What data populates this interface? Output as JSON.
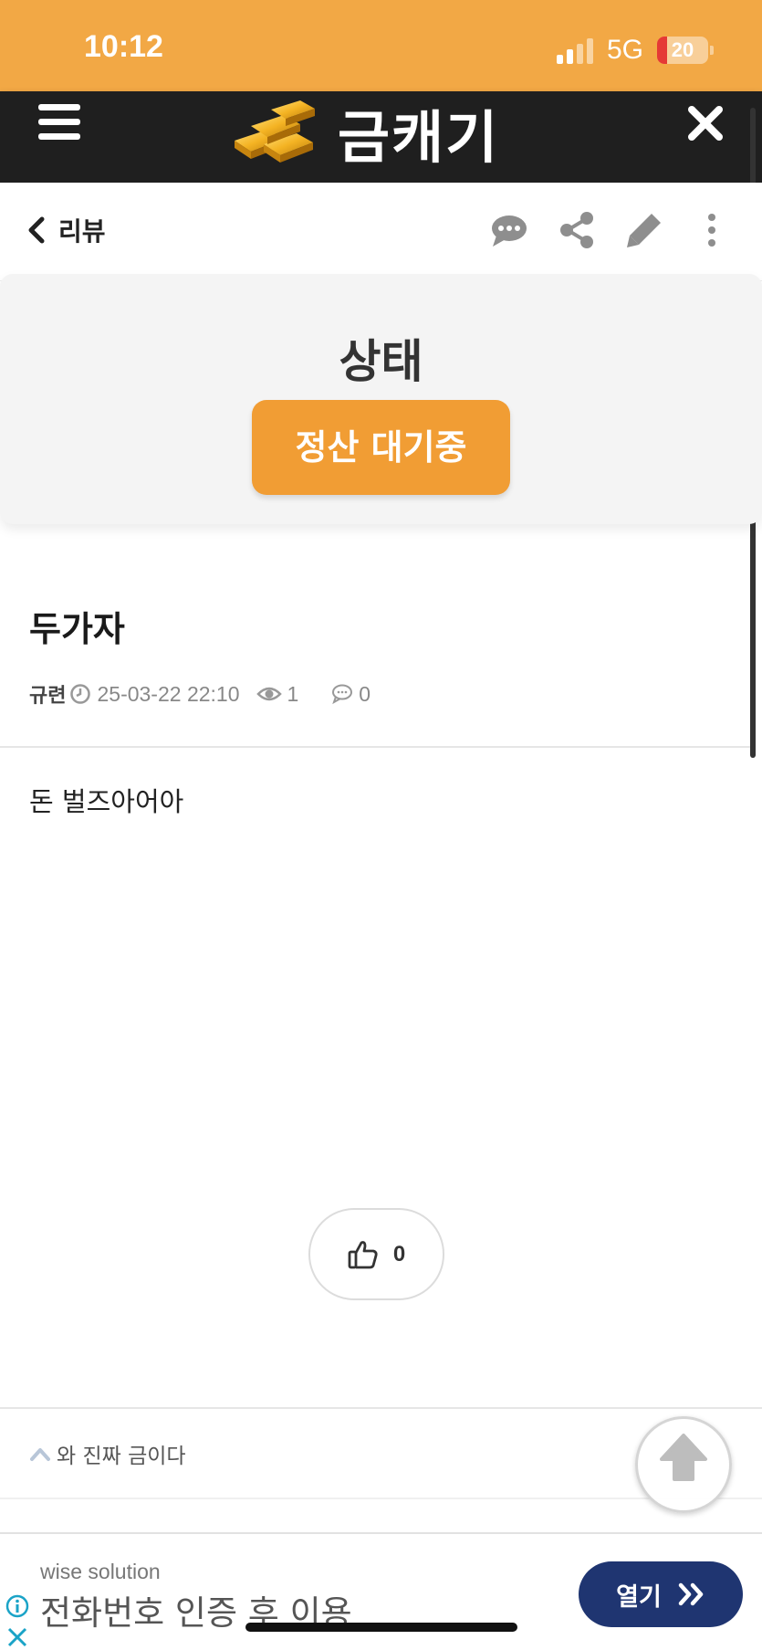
{
  "status_bar": {
    "time": "10:12",
    "network": "5G",
    "battery": "20",
    "battery_level": 0.2,
    "battery_color": "#e53935"
  },
  "header": {
    "logo_text": "금캐기",
    "logo_icon": "gold-bars-icon",
    "menu_icon": "hamburger-menu-icon",
    "close_icon": "close-icon",
    "background": "#1f1f1f"
  },
  "subheader": {
    "back_label": "리뷰",
    "actions": [
      "comment-icon",
      "share-icon",
      "edit-icon",
      "more-vertical-icon"
    ]
  },
  "status_card": {
    "title": "상태",
    "badge": "정산 대기중",
    "badge_color": "#f19d34"
  },
  "post": {
    "title": "두가자",
    "author": "규련",
    "date": "25-03-22 22:10",
    "views": "1",
    "comments": "0",
    "body": "돈 벌즈아어아"
  },
  "like": {
    "count": "0"
  },
  "navigation": {
    "prev_label": "와 진짜 금이다"
  },
  "ad": {
    "source": "wise solution",
    "text": "전화번호 인증 후 이용",
    "button": "열기",
    "button_color": "#1f3571"
  },
  "accent_color": "#f2a845"
}
